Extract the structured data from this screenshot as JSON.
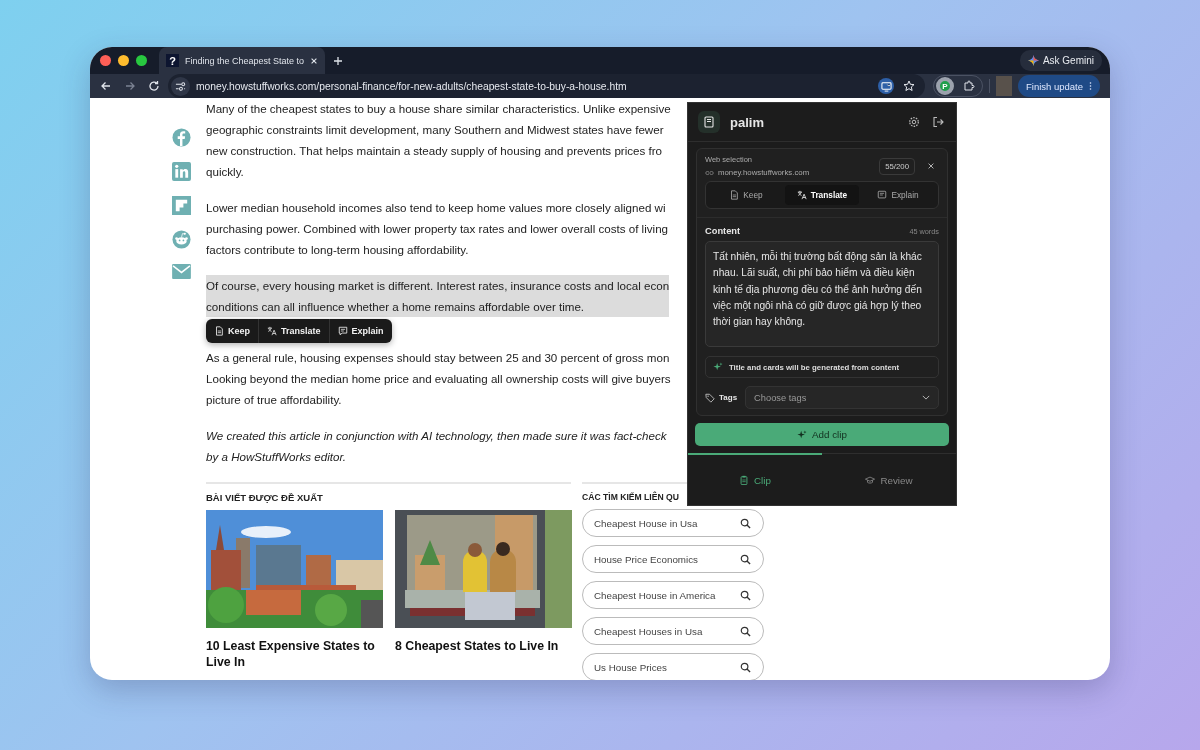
{
  "browser": {
    "tabs": [
      {
        "title": "Finding the Cheapest State to",
        "favicon": "?",
        "selected": true
      }
    ],
    "nav": [
      {
        "kind": "back",
        "disabled": false
      },
      {
        "kind": "forward",
        "disabled": true
      },
      {
        "kind": "reload",
        "disabled": false
      }
    ],
    "url": "money.howstuffworks.com/personal-finance/for-new-adults/cheapest-state-to-buy-a-house.htm",
    "gemini_button": "Ask Gemini",
    "extension_badge": "P",
    "update_button": "Finish update"
  },
  "article": {
    "paragraphs": [
      {
        "italic": false,
        "highlighted": false,
        "lines": [
          "Many of the cheapest states to buy a house share similar characteristics. Unlike expensive",
          "geographic constraints limit development, many Southern and Midwest states have fewer",
          "new construction. That helps maintain a steady supply of housing and prevents prices fro",
          "quickly."
        ]
      },
      {
        "italic": false,
        "highlighted": false,
        "lines": [
          "Lower median household incomes also tend to keep home values more closely aligned wi",
          "purchasing power. Combined with lower property tax rates and lower overall costs of living",
          "factors contribute to long-term housing affordability."
        ]
      },
      {
        "italic": false,
        "highlighted": true,
        "lines": [
          "Of course, every housing market is different. Interest rates, insurance costs and local econ",
          "conditions can all influence whether a home remains affordable over time."
        ]
      },
      {
        "italic": false,
        "highlighted": false,
        "lines": [
          "As a general rule, housing expenses should stay between 25 and 30 percent of gross mon",
          "Looking beyond the median home price and evaluating all ownership costs will give buyers",
          "picture of true affordability."
        ]
      },
      {
        "italic": true,
        "highlighted": false,
        "lines": [
          "We created this article in conjunction with AI technology, then made sure it was fact-check",
          "by a HowStuffWorks editor."
        ]
      }
    ],
    "selection_toolbar": [
      {
        "kind": "keep",
        "label": "Keep"
      },
      {
        "kind": "translate",
        "label": "Translate"
      },
      {
        "kind": "explain",
        "label": "Explain"
      }
    ]
  },
  "recommended": {
    "heading": "BÀI VIẾT ĐƯỢC ĐỀ XUẤT",
    "cards": [
      {
        "kind": "city",
        "title": "10 Least Expensive States to Live In"
      },
      {
        "kind": "moving",
        "title": "8 Cheapest States to Live In"
      }
    ]
  },
  "related_searches": {
    "heading": "CÁC TÌM KIẾM LIÊN QU",
    "items": [
      "Cheapest House in Usa",
      "House Price Economics",
      "Cheapest House in America",
      "Cheapest Houses in Usa",
      "Us House Prices"
    ]
  },
  "panel": {
    "title": "palim",
    "source_label": "Web selection",
    "source_domain": "money.howstuffworks.com",
    "char_count": "55/200",
    "actions": [
      {
        "kind": "keep",
        "label": "Keep",
        "selected": false
      },
      {
        "kind": "translate",
        "label": "Translate",
        "selected": true
      },
      {
        "kind": "explain",
        "label": "Explain",
        "selected": false
      }
    ],
    "content_label": "Content",
    "word_count": "45 words",
    "content": "Tất nhiên, mỗi thị trường bất động sản là khác nhau. Lãi suất, chi phí bảo hiểm và điều kiện kinh tế địa phương đều có thể ảnh hưởng đến việc một ngôi nhà có giữ được giá hợp lý theo thời gian hay không.",
    "info": "Title and cards will be generated from content",
    "tags_label": "Tags",
    "tags_placeholder": "Choose tags",
    "add_button": "Add clip",
    "tabs": [
      {
        "kind": "clip",
        "label": "Clip",
        "selected": true
      },
      {
        "kind": "review",
        "label": "Review",
        "selected": false
      }
    ]
  }
}
